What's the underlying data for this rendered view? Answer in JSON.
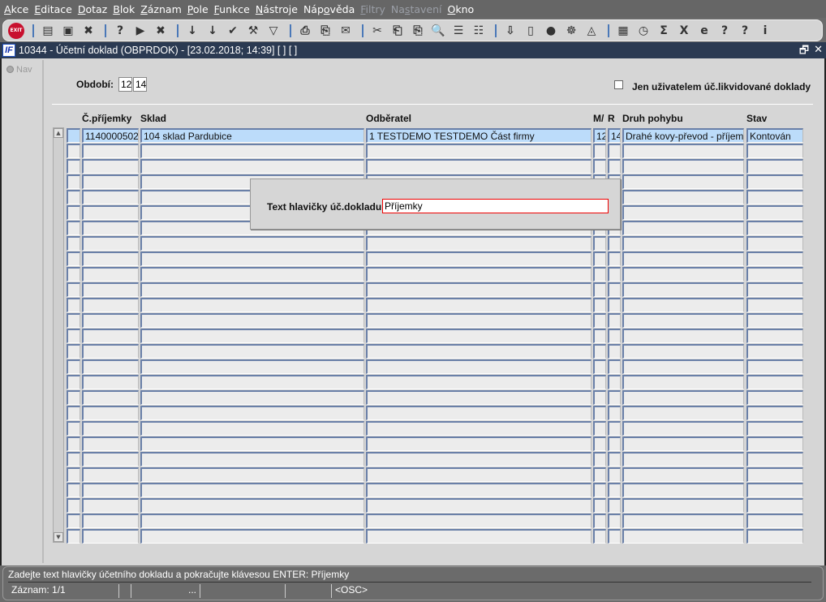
{
  "menu": [
    {
      "pre": "",
      "u": "A",
      "post": "kce"
    },
    {
      "pre": "",
      "u": "E",
      "post": "ditace"
    },
    {
      "pre": "",
      "u": "D",
      "post": "otaz"
    },
    {
      "pre": "",
      "u": "B",
      "post": "lok"
    },
    {
      "pre": "",
      "u": "Z",
      "post": "áznam"
    },
    {
      "pre": "",
      "u": "P",
      "post": "ole"
    },
    {
      "pre": "",
      "u": "F",
      "post": "unkce"
    },
    {
      "pre": "",
      "u": "N",
      "post": "ástroje"
    },
    {
      "pre": "Náp",
      "u": "o",
      "post": "věda"
    },
    {
      "pre": "",
      "u": "F",
      "post": "iltry",
      "disabled": true
    },
    {
      "pre": "Na",
      "u": "s",
      "post": "tavení",
      "disabled": true
    },
    {
      "pre": "",
      "u": "O",
      "post": "kno"
    }
  ],
  "toolbar": {
    "exit_label": "EXIT",
    "icons": [
      "insert-record-icon",
      "duplicate-record-icon",
      "delete-record-icon",
      "|",
      "query-icon",
      "execute-query-icon",
      "cancel-query-icon",
      "|",
      "sort-asc-icon",
      "sort-desc-icon",
      "commit-icon",
      "tools-icon",
      "filter-icon",
      "|",
      "print-icon",
      "print-setup-icon",
      "mail-icon",
      "|",
      "cut-icon",
      "copy-icon",
      "paste-icon",
      "search-icon",
      "tree-icon",
      "tree-expand-icon",
      "|",
      "import-icon",
      "document-icon",
      "globe-icon",
      "wheel-icon",
      "eye-icon",
      "|",
      "report-icon",
      "clock-icon",
      "sum-icon",
      "excel-icon",
      "browser-icon",
      "help-context-icon",
      "help-icon",
      "info-icon"
    ],
    "glyphs": {
      "insert-record-icon": "▤",
      "duplicate-record-icon": "▣",
      "delete-record-icon": "✖",
      "query-icon": "?",
      "execute-query-icon": "▶",
      "cancel-query-icon": "✖",
      "sort-asc-icon": "↓",
      "sort-desc-icon": "↓",
      "commit-icon": "✔",
      "tools-icon": "⚒",
      "filter-icon": "▽",
      "print-icon": "⎙",
      "print-setup-icon": "⎘",
      "mail-icon": "✉",
      "cut-icon": "✂",
      "copy-icon": "⎗",
      "paste-icon": "⎘",
      "search-icon": "🔍",
      "tree-icon": "☰",
      "tree-expand-icon": "☷",
      "import-icon": "⇩",
      "document-icon": "▯",
      "globe-icon": "●",
      "wheel-icon": "☸",
      "eye-icon": "◬",
      "report-icon": "▦",
      "clock-icon": "◷",
      "sum-icon": "Σ",
      "excel-icon": "X",
      "browser-icon": "e",
      "help-context-icon": "?",
      "help-icon": "?",
      "info-icon": "i"
    }
  },
  "window": {
    "logo": "IF",
    "title": "10344 - Účetní doklad (OBPRDOK) - [23.02.2018; 14:39]  [ ]  [ ]",
    "restore": "🗗",
    "close": "✕"
  },
  "nav": {
    "label": "Nav"
  },
  "filters": {
    "obdobi_label": "Období:",
    "month": "12",
    "year": "14",
    "checkbox_label": "Jen uživatelem úč.likvidované doklady",
    "checkbox_checked": false
  },
  "table": {
    "headers": [
      "",
      "Č.příjemky",
      "Sklad",
      "Odběratel",
      "M/",
      "R",
      "Druh pohybu",
      "Stav"
    ],
    "rows": [
      [
        "",
        "1140000502",
        "104 sklad Pardubice",
        "1 TESTDEMO TESTDEMO Část firmy",
        "12",
        "14",
        "Drahé kovy-převod - příjem",
        "Kontován"
      ]
    ]
  },
  "dialog": {
    "label": "Text hlavičky úč.dokladu",
    "value": "Příjemky"
  },
  "status": {
    "message": "Zadejte text hlavičky účetního dokladu a pokračujte klávesou ENTER: Příjemky",
    "record": "Záznam: 1/1",
    "f3": "...",
    "f6": "<OSC>"
  },
  "colors": {
    "selected_row": "#bcdcfa",
    "title_bar": "#2b3a52",
    "active_field_border": "#e00000"
  }
}
